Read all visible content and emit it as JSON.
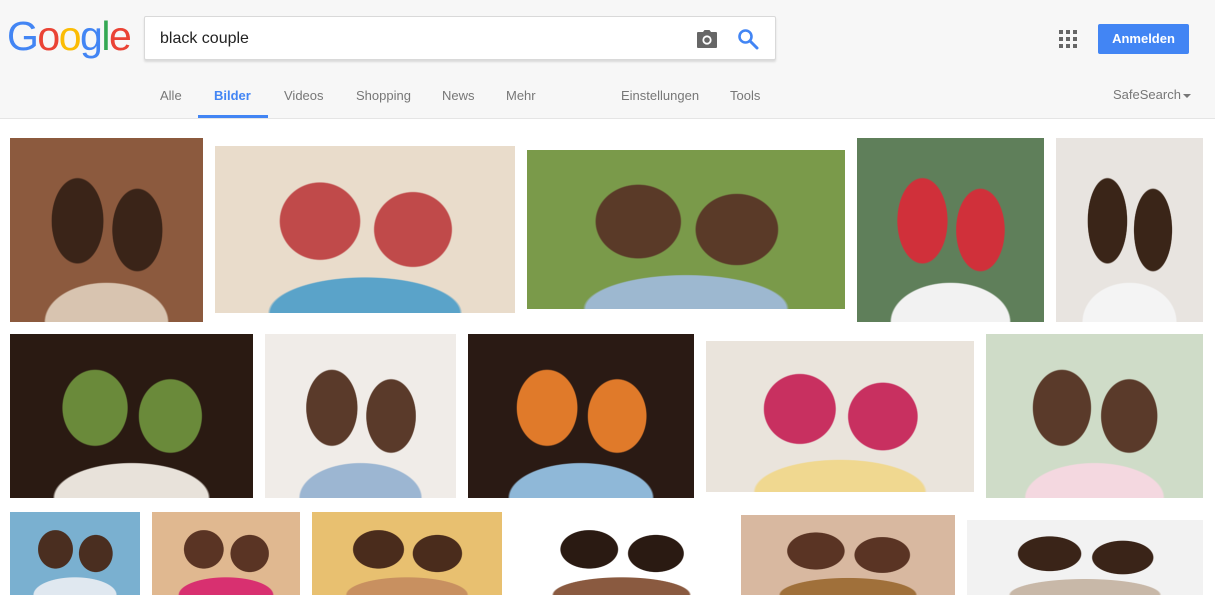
{
  "logo": {
    "letters": [
      "G",
      "o",
      "o",
      "g",
      "l",
      "e"
    ],
    "colors": [
      "#4285f4",
      "#ea4335",
      "#fbbc05",
      "#4285f4",
      "#34a853",
      "#ea4335"
    ]
  },
  "search": {
    "value": "black couple",
    "camera_icon": "camera-icon",
    "search_icon": "search-icon"
  },
  "header": {
    "apps_icon": "apps-grid-icon",
    "signin_label": "Anmelden"
  },
  "tabs": [
    {
      "label": "Alle",
      "active": false
    },
    {
      "label": "Bilder",
      "active": true
    },
    {
      "label": "Videos",
      "active": false
    },
    {
      "label": "Shopping",
      "active": false
    },
    {
      "label": "News",
      "active": false
    },
    {
      "label": "Mehr",
      "active": false
    },
    {
      "label": "Einstellungen",
      "active": false
    },
    {
      "label": "Tools",
      "active": false
    }
  ],
  "safesearch": {
    "label": "SafeSearch"
  },
  "colors": {
    "accent": "#4285f4",
    "tab_text": "#777777",
    "topbar_bg": "#f7f7f7"
  },
  "results": [
    {
      "name": "image-result-1",
      "palette": [
        "#8c5a3e",
        "#3a2418",
        "#d8c4b0"
      ]
    },
    {
      "name": "image-result-2",
      "palette": [
        "#e9dccb",
        "#c04a4a",
        "#5aa3c9"
      ]
    },
    {
      "name": "image-result-3",
      "palette": [
        "#7a9a4a",
        "#5a3a28",
        "#9db8d0"
      ]
    },
    {
      "name": "image-result-4",
      "palette": [
        "#5f7f5a",
        "#d0303a",
        "#f2f2f2"
      ]
    },
    {
      "name": "image-result-5",
      "palette": [
        "#e8e4e0",
        "#3a2518",
        "#f4f4f4"
      ]
    },
    {
      "name": "image-result-6",
      "palette": [
        "#2a1a12",
        "#6a8a3a",
        "#e8e2da"
      ]
    },
    {
      "name": "image-result-7",
      "palette": [
        "#f0ece8",
        "#5a3a2a",
        "#9cb6d2"
      ]
    },
    {
      "name": "image-result-8",
      "palette": [
        "#2a1a14",
        "#e07a2a",
        "#8fb8d8"
      ]
    },
    {
      "name": "image-result-9",
      "palette": [
        "#eae4dc",
        "#c83060",
        "#f0d890"
      ]
    },
    {
      "name": "image-result-10",
      "palette": [
        "#cfdcc8",
        "#5a3a2a",
        "#f4d8e0"
      ]
    },
    {
      "name": "image-result-11",
      "palette": [
        "#7ab0d0",
        "#4a2e20",
        "#e0e8f0"
      ]
    },
    {
      "name": "image-result-12",
      "palette": [
        "#e0b890",
        "#5a3424",
        "#d83070"
      ]
    },
    {
      "name": "image-result-13",
      "palette": [
        "#e8c070",
        "#4a2c1c",
        "#c89060"
      ]
    },
    {
      "name": "image-result-14",
      "palette": [
        "#ffffff",
        "#2a1a12",
        "#8a5a40"
      ]
    },
    {
      "name": "image-result-15",
      "palette": [
        "#d8b8a0",
        "#5a3424",
        "#a0703a"
      ]
    },
    {
      "name": "image-result-16",
      "palette": [
        "#f2f2f2",
        "#3a2418",
        "#c8b8a8"
      ]
    }
  ]
}
